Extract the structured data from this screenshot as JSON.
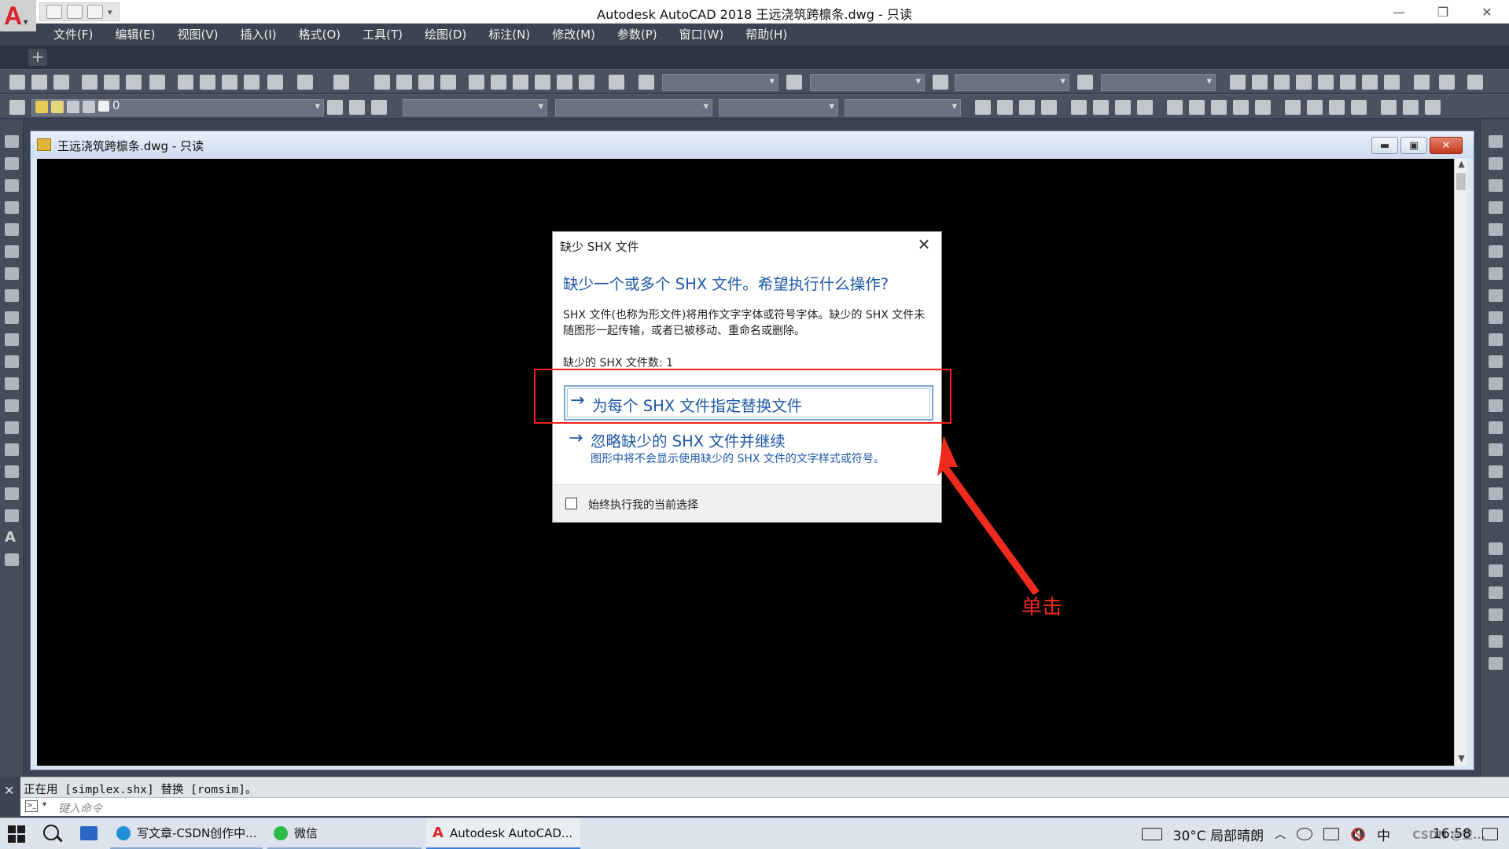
{
  "app": {
    "title": "Autodesk AutoCAD 2018    王远浇筑跨檩条.dwg - 只读",
    "logo": "A"
  },
  "menu": [
    "文件(F)",
    "编辑(E)",
    "视图(V)",
    "插入(I)",
    "格式(O)",
    "工具(T)",
    "绘图(D)",
    "标注(N)",
    "修改(M)",
    "参数(P)",
    "窗口(W)",
    "帮助(H)"
  ],
  "toolbar": {
    "layer_value": "0"
  },
  "drawing_window": {
    "title": "王远浇筑跨檩条.dwg - 只读"
  },
  "dialog": {
    "title": "缺少 SHX 文件",
    "heading": "缺少一个或多个 SHX 文件。希望执行什么操作?",
    "description": "SHX 文件(也称为形文件)将用作文字字体或符号字体。缺少的 SHX 文件未随图形一起传输，或者已被移动、重命名或删除。",
    "count_label": "缺少的 SHX 文件数:",
    "count_value": "1",
    "option1": "为每个 SHX 文件指定替换文件",
    "option2": "忽略缺少的 SHX 文件并继续",
    "option2_sub": "图形中将不会显示使用缺少的 SHX 文件的文字样式或符号。",
    "checkbox_label": "始终执行我的当前选择",
    "checkbox_checked": false
  },
  "annotation": {
    "label": "单击",
    "color": "#ee2a1f"
  },
  "command": {
    "output": "正在用 [simplex.shx] 替换 [romsim]。",
    "placeholder": "键入命令"
  },
  "taskbar": {
    "items": [
      {
        "label": "写文章-CSDN创作中...",
        "icon": "edge-icon"
      },
      {
        "label": "微信",
        "icon": "wechat-icon"
      },
      {
        "label": "Autodesk AutoCAD...",
        "icon": "autocad-icon"
      }
    ],
    "weather": "30°C  局部晴朗",
    "ime": "中",
    "time": "16:58",
    "watermark": "CSDN @空..."
  },
  "colors": {
    "accent_link": "#1d57a7",
    "annotation_red": "#f0201a",
    "canvas": "#000000"
  }
}
